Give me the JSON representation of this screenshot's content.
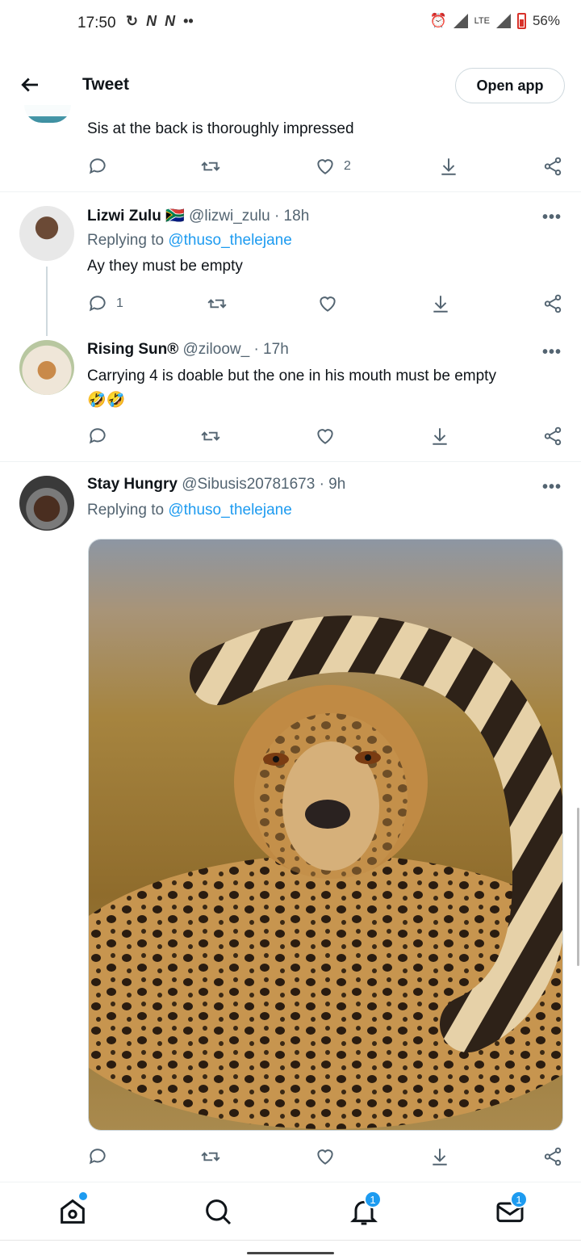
{
  "status_bar": {
    "time": "17:50",
    "network": "LTE",
    "battery": "56%",
    "left_icons": [
      "sync-icon",
      "n-icon",
      "n-icon",
      "more-dots-icon"
    ],
    "right_icons": [
      "alarm-icon",
      "signal-icon",
      "lte-icon",
      "signal-icon",
      "battery-icon"
    ]
  },
  "header": {
    "title": "Tweet",
    "open_app_label": "Open app"
  },
  "tweets": [
    {
      "text": "Sis at the back is thoroughly impressed",
      "reply_count": "",
      "retweet_count": "",
      "like_count": "2"
    },
    {
      "name": "Lizwi Zulu",
      "flag": "🇿🇦",
      "handle": "@lizwi_zulu",
      "time": "· 18h",
      "replying_prefix": "Replying to",
      "replying_to": "@thuso_thelejane",
      "text": "Ay they must be empty",
      "reply_count": "1"
    },
    {
      "name": "Rising Sun®",
      "handle": "@ziloow_",
      "time": "· 17h",
      "text": "Carrying 4 is doable but the one in his mouth must be empty",
      "emojis": "🤣🤣"
    },
    {
      "name": "Stay Hungry",
      "handle": "@Sibusis20781673",
      "time": "· 9h",
      "replying_prefix": "Replying to",
      "replying_to": "@thuso_thelejane"
    }
  ],
  "more_label": "•••",
  "bottom_nav": {
    "items": [
      "home-icon",
      "search-icon",
      "notifications-icon",
      "messages-icon"
    ],
    "notifications_badge": "1",
    "messages_badge": "1"
  },
  "colors": {
    "accent": "#1d9bf0",
    "text": "#0f1419",
    "secondary": "#536471",
    "border": "#cfd9de"
  }
}
